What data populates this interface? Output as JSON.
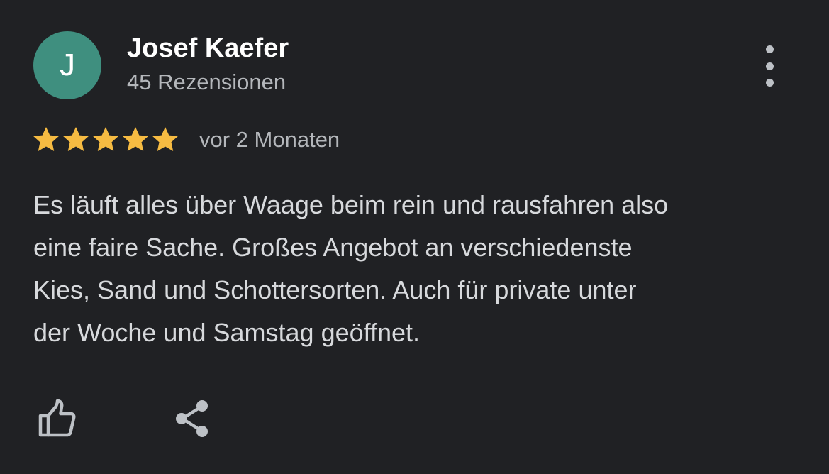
{
  "colors": {
    "background": "#202124",
    "avatar_bg": "#3f8f7f",
    "star": "#f6bb42",
    "text_primary": "#ffffff",
    "text_secondary": "#b4b7bb",
    "icon": "#bdc1c6"
  },
  "reviewer": {
    "initial": "J",
    "name": "Josef Kaefer",
    "review_count": "45 Rezensionen"
  },
  "review": {
    "rating": 5,
    "rating_max": 5,
    "date": "vor 2 Monaten",
    "lines": [
      "Es läuft alles über Waage beim rein und rausfahren also",
      "eine faire Sache. Großes Angebot an verschiedenste",
      "Kies, Sand und Schottersorten. Auch für private unter",
      "der Woche und Samstag geöffnet."
    ]
  },
  "icons": {
    "menu": "more-vert-icon",
    "like": "thumb-up-icon",
    "share": "share-icon",
    "star": "star-icon"
  }
}
